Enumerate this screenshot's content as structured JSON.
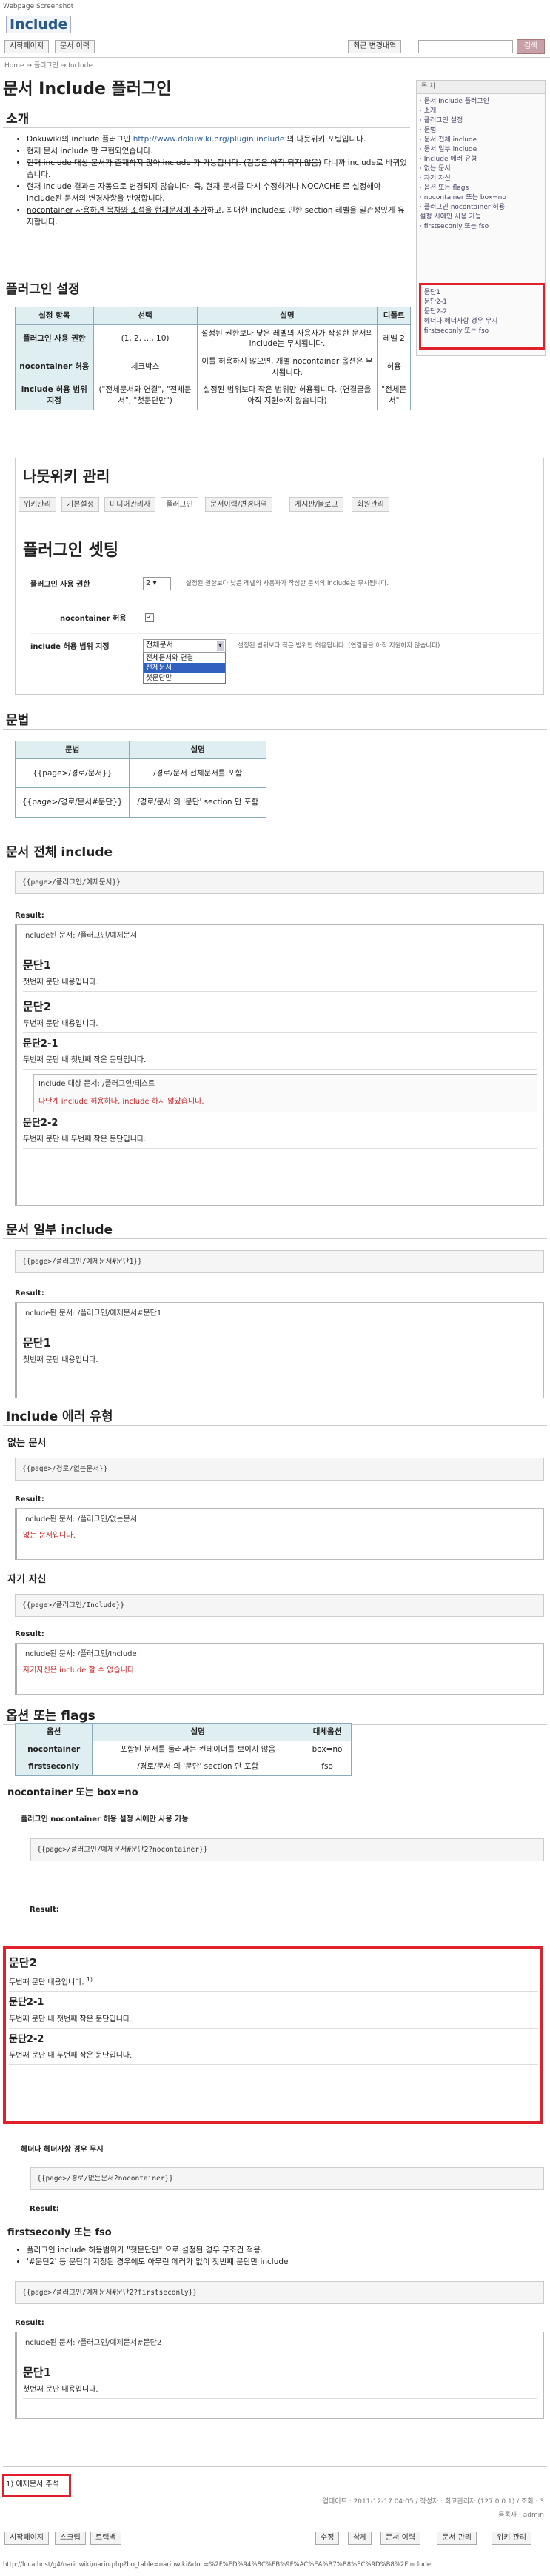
{
  "caption": "Webpage Screenshot",
  "site_title": "Include",
  "top": {
    "btn1": "시작페이지",
    "btn2": "문서 이력",
    "btn3": "최근 변경내역",
    "search": "검색"
  },
  "breadcrumb": "Home → 플러그인 → Include",
  "page_title": "문서 Include 플러그인",
  "toc": {
    "title": "목 차",
    "items": [
      "· 문서 Include 플러그인",
      "  · 소개",
      "  · 플러그인 설정",
      "  · 문법",
      "  · 문서 전체 include",
      "  · 문서 일부 include",
      "  · Include 에러 유형",
      "    · 없는 문서",
      "    · 자기 자신",
      "  · 옵션 또는 flags",
      "    · nocontainer 또는 box=no",
      "      · 플러그인 nocontainer 허용",
      "        설정 시에만 사용 가능",
      "    · firstseconly 또는 fso"
    ],
    "red": [
      "· 문단1",
      "  · 문단2-1",
      "  · 문단2-2",
      "· 헤더나 헤더사항 경우 무시",
      "· firstseconly 또는 fso"
    ]
  },
  "intro": {
    "h": "소개",
    "l1": "Dokuwiki의 include 플러그인 ",
    "link": "http://www.dokuwiki.org/plugin:include",
    "l1b": " 의 나뭇위키 포팅입니다.",
    "l2": "현재 문서 include 만 구현되었습니다.",
    "l3": "현재 include 대상 문서가 존재하지 않아 include 가 가능합니다. (검증은 아직 되지 않음)",
    "l3b": " 다니까 include로 바뀌었습니다.",
    "l4": "현재 include 결과는 자동으로 변경되지 않습니다. 즉, 현재 문서를 다시 수정하거나 NOCACHE 로 설정해야 include된 문서의 변경사항을 반영합니다.",
    "l5a": "nocontainer 사용하면 목차와 조석을 현재문서에 추가",
    "l5b": "하고, 최대한 include로 인한 section 레벨을 일관성있게 유지합니다."
  },
  "settings": {
    "h": "플러그인 설정",
    "cols": [
      "설정 항목",
      "선택",
      "설명",
      "디폴트"
    ],
    "rows": [
      [
        "플러그인 사용 권한",
        "(1, 2, ..., 10)",
        "설정된 권한보다 낮은 레벨의 사용자가 작성한 문서의 include는 무시됩니다.",
        "레벨 2"
      ],
      [
        "nocontainer 허용",
        "체크박스",
        "이를 허용하지 않으면, 개별 nocontainer 옵션은 무시됩니다.",
        "허용"
      ],
      [
        "include 허용 범위 지정",
        "(\"전체문서와 연결\", \"전체문서\", \"첫문단만\")",
        "설정된 범위보다 작은 범위만 허용됩니다. (연결글을 아직 지원하지 않습니다)",
        "\"전체문서\""
      ]
    ]
  },
  "mgmt": {
    "h": "나뭇위키 관리",
    "tabs": [
      "위키관리",
      "기본설정",
      "미디어관리자",
      "플러그인",
      "문서이력/변경내역",
      "게시판/블로그",
      "회원관리"
    ],
    "sub": "플러그인 셋팅",
    "r1l": "플러그인 사용 권한",
    "r1v": "2",
    "r1d": "설정된 권한보다 낮은 레벨의 사용자가 작성한 문서의 include는 무시됩니다.",
    "r2l": "nocontainer 허용",
    "r3l": "include 허용 범위 지정",
    "r3v": "전체문서",
    "r3d": "설정된 범위보다 작은 범위만 허용됩니다. (연결글을 아직 지원하지 않습니다)",
    "opts": [
      "전체문서와 연결",
      "전체문서",
      "첫문단만"
    ]
  },
  "syntax": {
    "h": "문법",
    "cols": [
      "문법",
      "설명"
    ],
    "rows": [
      [
        "{{page>/경로/문서}}",
        "/경로/문서 전체문서를 포함"
      ],
      [
        "{{page>/경로/문서#문단}}",
        "/경로/문서 의 '문단' section 만 포함"
      ]
    ]
  },
  "full": {
    "h": "문서 전체 include",
    "code": "{{page>/플러그인/예제문서}}",
    "res": "Result:",
    "note": "Include된 문서: /플러그인/예제문서",
    "s1": "문단1",
    "t1": "첫번째 문단 내용입니다.",
    "s2": "문단2",
    "t2": "두번째 문단 내용입니다.",
    "s21": "문단2-1",
    "t21": "두번째 문단 내 첫번째 작은 문단입니다.",
    "inote": "Include 대상 문서: /플러그인/테스트",
    "ierr": "다단계 include 허용하나, include 하지 않았습니다.",
    "s22": "문단2-2",
    "t22": "두번째 문단 내 두번째 작은 문단입니다."
  },
  "part": {
    "h": "문서 일부 include",
    "code": "{{page>/플러그인/예제문서#문단1}}",
    "res": "Result:",
    "note": "Include된 문서: /플러그인/예제문서#문단1",
    "s1": "문단1",
    "t1": "첫번째 문단 내용입니다."
  },
  "errs": {
    "h": "Include 에러 유형",
    "h1": "없는 문서",
    "c1": "{{page>/경로/없는문서}}",
    "r1": "Result:",
    "n1": "Include된 문서: /플러그인/없는문서",
    "e1": "없는 문서입니다.",
    "h2": "자기 자신",
    "c2": "{{page>/플러그인/Include}}",
    "r2": "Result:",
    "n2": "Include된 문서: /플러그인/Include",
    "e2": "자기자신은 include 할 수 없습니다."
  },
  "flags": {
    "h": "옵션 또는 flags",
    "cols": [
      "옵션",
      "설명",
      "대체옵션"
    ],
    "rows": [
      [
        "nocontainer",
        "포함된 문서를 둘러싸는 컨테이너를 보이지 않음",
        "box=no"
      ],
      [
        "firstseconly",
        "/경로/문서 의 '문단' section 만 포함",
        "fso"
      ]
    ],
    "h1": "nocontainer 또는 box=no",
    "h1b": "플러그인 nocontainer 허용 설정 시에만 사용 가능",
    "c1": "{{page>/플러그인/예제문서#문단2?nocontainer}}",
    "r1": "Result:",
    "s2": "문단2",
    "t2": "두번째 문단 내용입니다.",
    "fn": "1)",
    "s21": "문단2-1",
    "t21": "두번째 문단 내 첫번째 작은 문단입니다.",
    "s22": "문단2-2",
    "t22": "두번째 문단 내 두번째 작은 문단입니다.",
    "h2": "헤더나 헤더사항 경우 무시",
    "c2": "{{page>/경로/없는문서?nocontainer}}",
    "r2": "Result:",
    "h3": "firstseconly 또는 fso",
    "b1": "플러그인 include 허용범위가 \"첫문단만\" 으로 설정된 경우 무조건 적용.",
    "b2": "'#문단2' 등 문단이 지정된 경우에도 아무런 에러가 없이 첫번째 문단만 include",
    "c3": "{{page>/플러그인/예제문서#문단2?firstseconly}}",
    "r3": "Result:",
    "n3": "Include된 문서: /플러그인/예제문서#문단2",
    "s3": "문단1",
    "t3": "첫번째 문단 내용입니다."
  },
  "footnote": "1) 예제문서 주석",
  "meta1": "업데이트 : 2011-12-17 04:05 / 작성자 : 최고관리자 (127.0.0.1) / 조회 : 3",
  "meta2": "등록자 : admin",
  "bottom": [
    "시작페이지",
    "스크랩",
    "트랙백",
    "수정",
    "삭제",
    "문서 이력",
    "문서 관리",
    "위키 관리"
  ],
  "url": "http://localhost/g4/narinwiki/narin.php?bo_table=narinwiki&doc=%2F%ED%94%8C%EB%9F%AC%EA%B7%B8%EC%9D%B8%2FInclude"
}
